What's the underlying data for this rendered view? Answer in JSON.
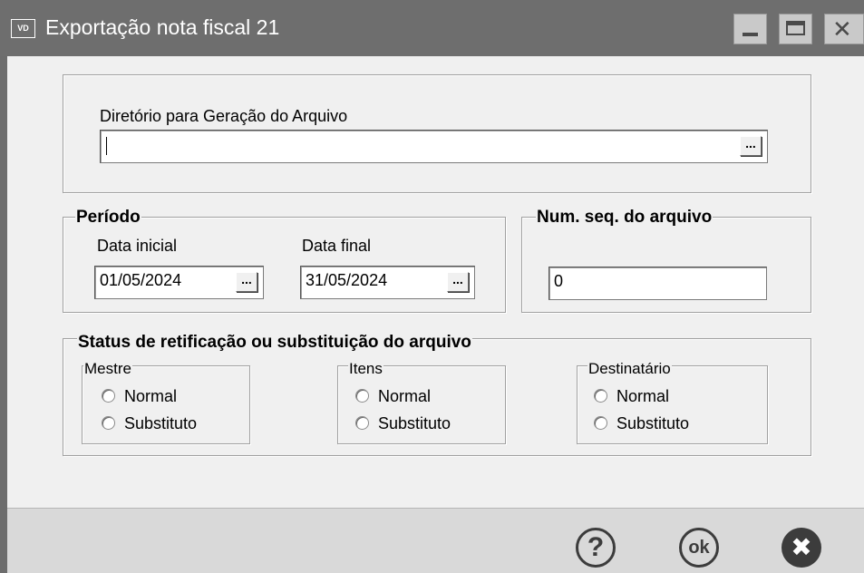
{
  "window": {
    "icon_text": "VD",
    "title": "Exportação nota fiscal 21",
    "minimize_icon": "minimize-icon",
    "maximize_icon": "maximize-icon",
    "close_icon": "close-icon"
  },
  "directory": {
    "label": "Diretório para Geração do Arquivo",
    "value": "",
    "browse_label": "..."
  },
  "period": {
    "title": "Período",
    "start_label": "Data inicial",
    "start_value": "01/05/2024",
    "end_label": "Data final",
    "end_value": "31/05/2024",
    "picker_label": "..."
  },
  "sequence": {
    "title": "Num. seq. do arquivo",
    "value": "0"
  },
  "status": {
    "title": "Status de retificação ou substituição do arquivo",
    "groups": [
      {
        "title": "Mestre",
        "options": [
          "Normal",
          "Substituto"
        ]
      },
      {
        "title": "Itens",
        "options": [
          "Normal",
          "Substituto"
        ]
      },
      {
        "title": "Destinatário",
        "options": [
          "Normal",
          "Substituto"
        ]
      }
    ]
  },
  "footer": {
    "help_label": "?",
    "ok_label": "ok",
    "cancel_label": "✖",
    "help_icon": "help-icon",
    "ok_icon": "ok-icon",
    "cancel_icon": "cancel-icon"
  }
}
